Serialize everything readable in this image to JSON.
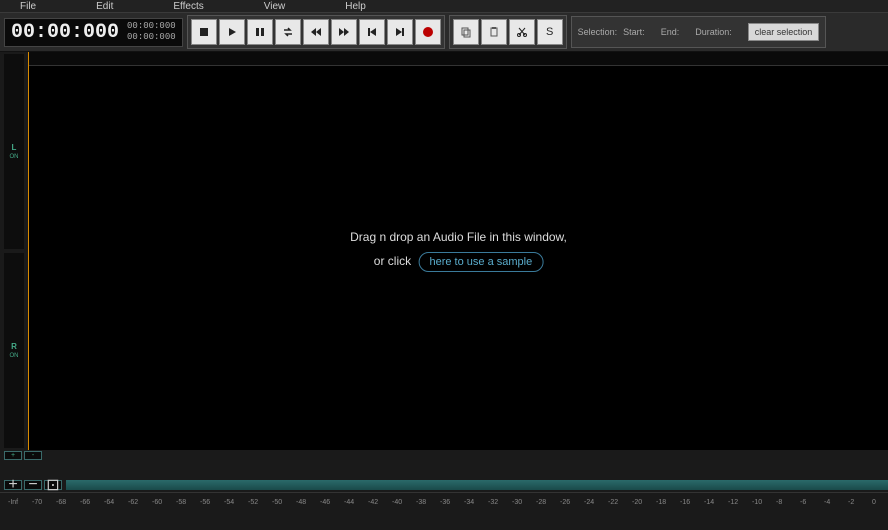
{
  "menu": {
    "items": [
      "File",
      "Edit",
      "Effects",
      "View",
      "Help"
    ]
  },
  "time": {
    "main": "00:00:000",
    "sub1": "00:00:000",
    "sub2": "00:00:000"
  },
  "transport": {
    "stop": "stop",
    "play": "play",
    "pause": "pause",
    "loop": "loop",
    "rewind": "rewind",
    "forward": "forward",
    "start": "start",
    "end": "end",
    "record": "record"
  },
  "clipboard": {
    "copy": "copy",
    "paste": "paste",
    "cut": "cut",
    "s": "S"
  },
  "selection": {
    "label": "Selection:",
    "start_label": "Start:",
    "end_label": "End:",
    "duration_label": "Duration:",
    "clear": "clear selection"
  },
  "channels": {
    "left": {
      "label": "L",
      "status": "ON"
    },
    "right": {
      "label": "R",
      "status": "ON"
    }
  },
  "empty": {
    "line1": "Drag n drop an Audio File in this window,",
    "line2": "or click",
    "sample_btn": "here to use a sample"
  },
  "zoom": {
    "in": "+",
    "out": "-"
  },
  "nav": {
    "in": "+",
    "out": "−",
    "fit": "⊡"
  },
  "db_ticks": [
    "-Inf",
    "-70",
    "-68",
    "-66",
    "-64",
    "-62",
    "-60",
    "-58",
    "-56",
    "-54",
    "-52",
    "-50",
    "-48",
    "-46",
    "-44",
    "-42",
    "-40",
    "-38",
    "-36",
    "-34",
    "-32",
    "-30",
    "-28",
    "-26",
    "-24",
    "-22",
    "-20",
    "-18",
    "-16",
    "-14",
    "-12",
    "-10",
    "-8",
    "-6",
    "-4",
    "-2",
    "0"
  ]
}
